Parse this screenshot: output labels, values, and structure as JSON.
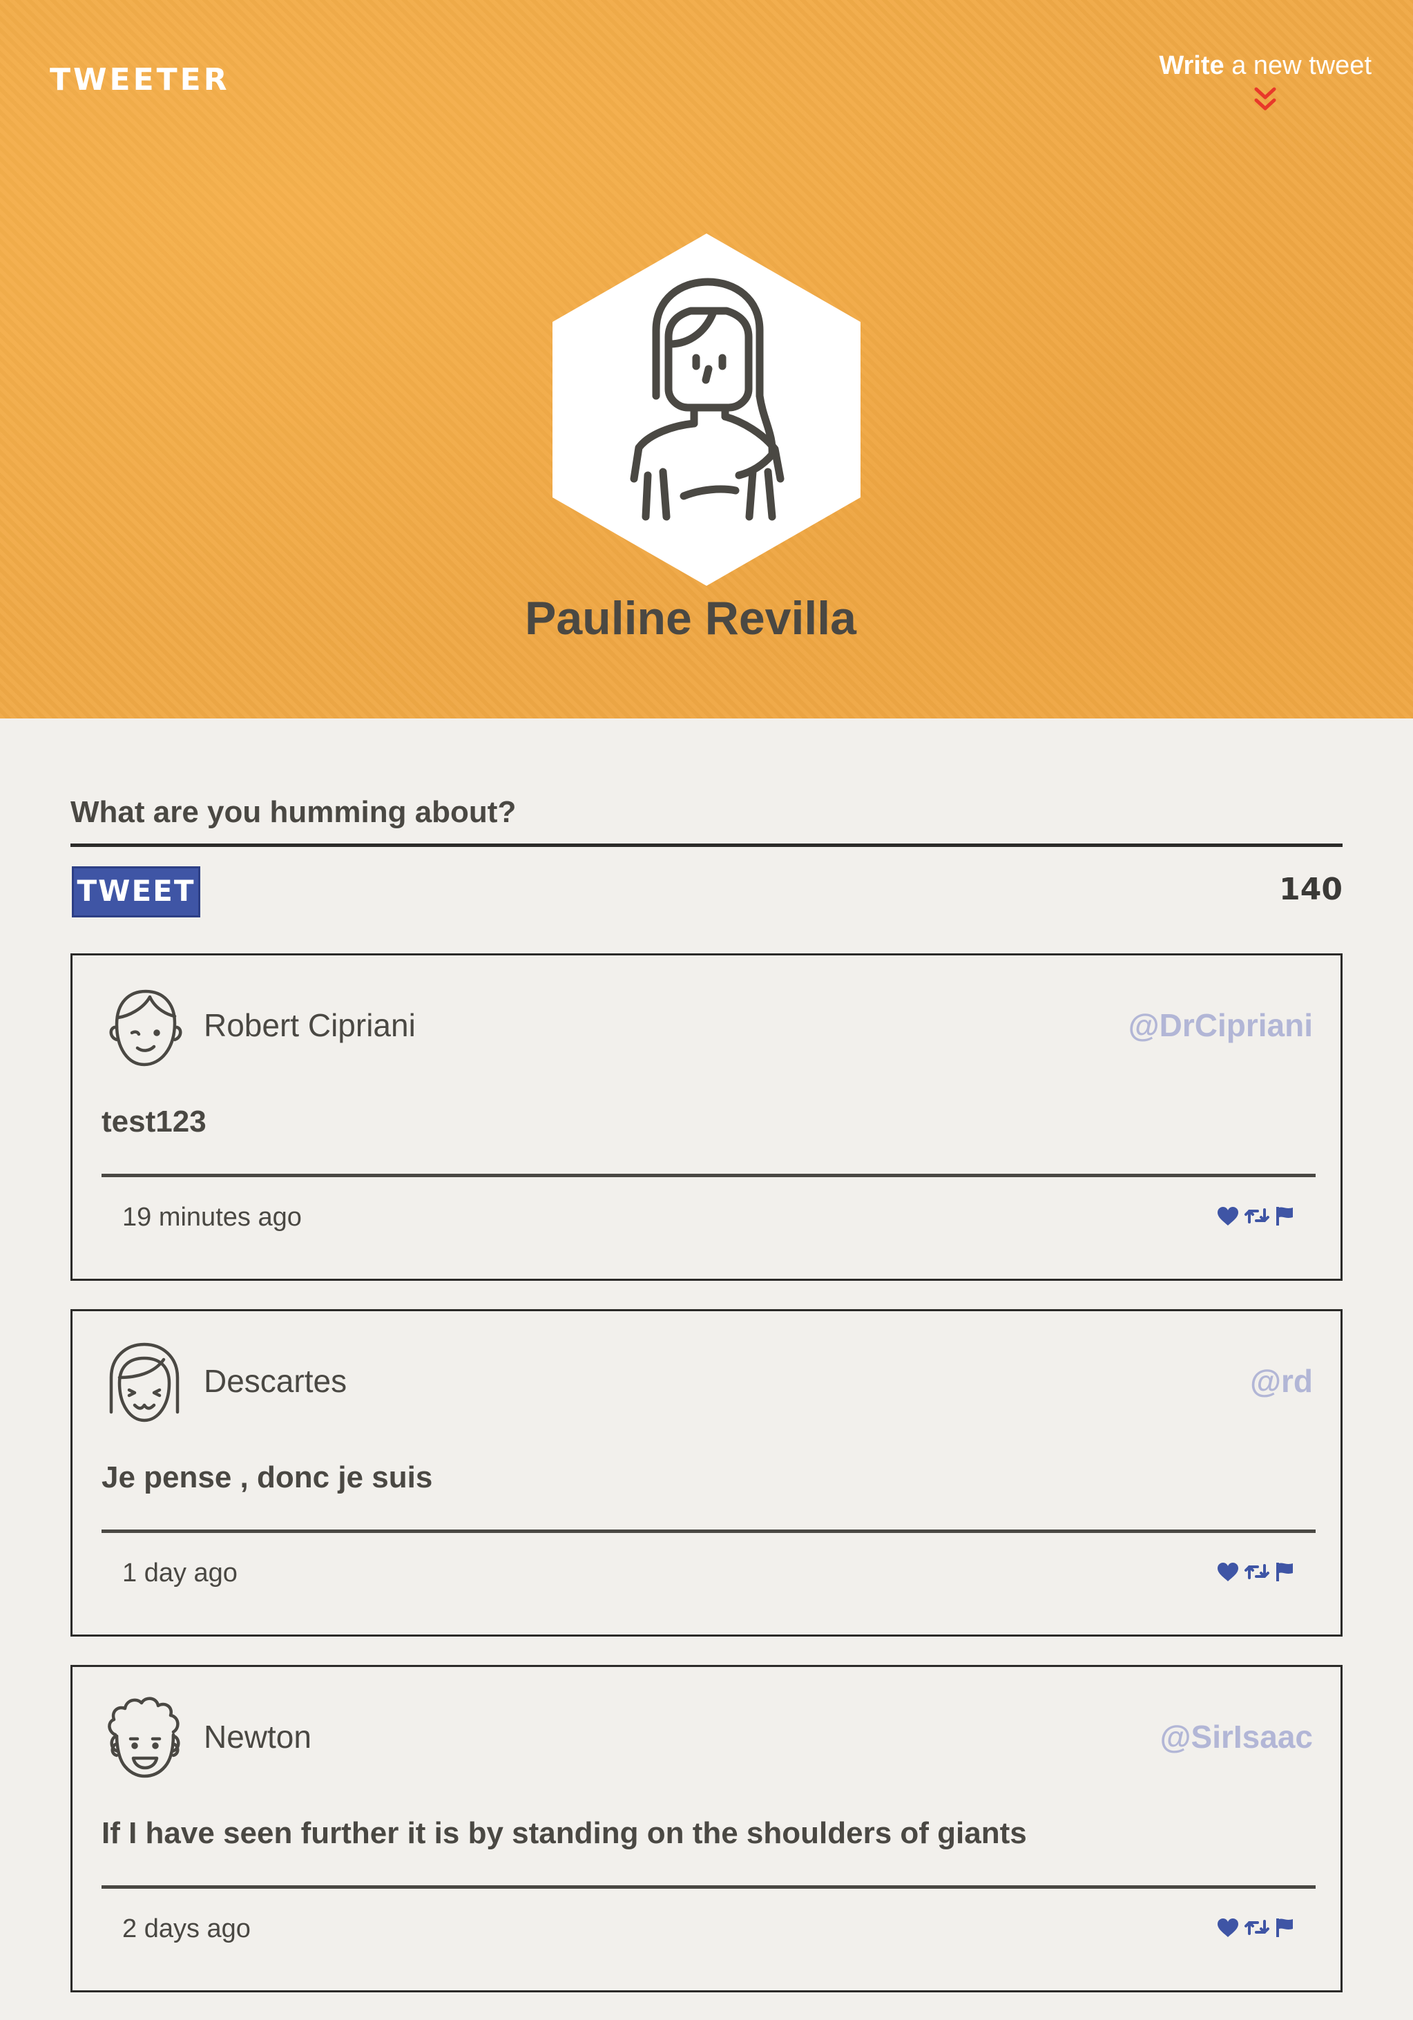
{
  "header": {
    "brand": "TWEETER",
    "write_link_bold": "Write",
    "write_link_rest": " a new tweet",
    "profile_name": "Pauline Revilla"
  },
  "compose": {
    "placeholder": "What are you humming about?",
    "button_label": "TWEET",
    "char_count": "140"
  },
  "colors": {
    "header_bg": "#f0a946",
    "page_bg": "#f2f0ec",
    "accent_blue": "#3f55a5",
    "handle": "#b2b6d6",
    "text": "#4a4843",
    "chevron": "#e8382a"
  },
  "tweets": [
    {
      "name": "Robert Cipriani",
      "handle": "@DrCipriani",
      "text": "test123",
      "time": "19 minutes ago",
      "avatar_icon": "boy-face-icon"
    },
    {
      "name": "Descartes",
      "handle": "@rd",
      "text": "Je pense , donc je suis",
      "time": "1 day ago",
      "avatar_icon": "bangs-face-icon"
    },
    {
      "name": "Newton",
      "handle": "@SirIsaac",
      "text": "If I have seen further it is by standing on the shoulders of giants",
      "time": "2 days ago",
      "avatar_icon": "curly-hair-face-icon"
    }
  ],
  "icons": {
    "like": "heart-icon",
    "retweet": "retweet-icon",
    "flag": "flag-icon",
    "write_indicator": "double-chevron-down-icon"
  }
}
